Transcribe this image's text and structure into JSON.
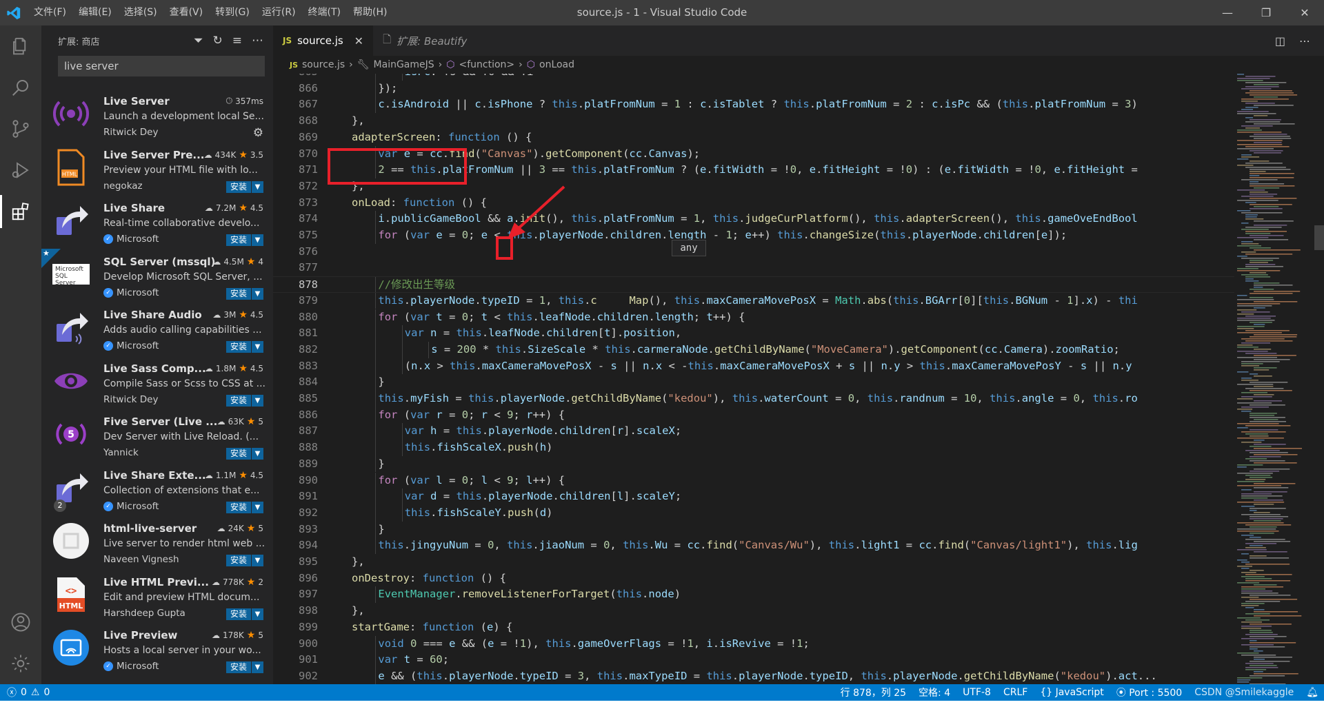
{
  "title_bar": {
    "menu": [
      "文件(F)",
      "编辑(E)",
      "选择(S)",
      "查看(V)",
      "转到(G)",
      "运行(R)",
      "终端(T)",
      "帮助(H)"
    ],
    "window_title": "source.js - 1 - Visual Studio Code",
    "controls": [
      "—",
      "❐",
      "✕"
    ]
  },
  "sidebar": {
    "header": "扩展: 商店",
    "search_value": "live server",
    "extensions": [
      {
        "name": "Live Server",
        "stats": "357ms",
        "stats_icon": "clock",
        "desc": "Launch a development local Se...",
        "publisher": "Ritwick Dey",
        "verified": false,
        "installed": true,
        "icon": "live-server"
      },
      {
        "name": "Live Server Pre...",
        "stats": "434K",
        "rating": "3.5",
        "desc": "Preview your HTML file with lo...",
        "publisher": "negokaz",
        "verified": false,
        "action": "安装",
        "icon": "html-file"
      },
      {
        "name": "Live Share",
        "stats": "7.2M",
        "rating": "4.5",
        "desc": "Real-time collaborative develo...",
        "publisher": "Microsoft",
        "verified": true,
        "action": "安装",
        "icon": "share-arrow"
      },
      {
        "name": "SQL Server (mssql)",
        "stats": "4.5M",
        "rating": "4",
        "desc": "Develop Microsoft SQL Server, ...",
        "publisher": "Microsoft",
        "verified": true,
        "action": "安装",
        "icon": "sql-server",
        "icon_text": "Microsoft SQL Server",
        "featured": true
      },
      {
        "name": "Live Share Audio",
        "stats": "3M",
        "rating": "4.5",
        "desc": "Adds audio calling capabilities ...",
        "publisher": "Microsoft",
        "verified": true,
        "action": "安装",
        "icon": "share-audio"
      },
      {
        "name": "Live Sass Comp...",
        "stats": "1.8M",
        "rating": "4.5",
        "desc": "Compile Sass or Scss to CSS at ...",
        "publisher": "Ritwick Dey",
        "verified": false,
        "action": "安装",
        "icon": "eye"
      },
      {
        "name": "Five Server (Live ...",
        "stats": "63K",
        "rating": "5",
        "desc": "Dev Server with Live Reload. (...",
        "publisher": "Yannick",
        "verified": false,
        "action": "安装",
        "icon": "five-server"
      },
      {
        "name": "Live Share Exte...",
        "stats": "1.1M",
        "rating": "4.5",
        "desc": "Collection of extensions that e...",
        "publisher": "Microsoft",
        "verified": true,
        "action": "安装",
        "icon": "share-arrow",
        "badge": "2"
      },
      {
        "name": "html-live-server",
        "stats": "24K",
        "rating": "5",
        "desc": "Live server to render html web ...",
        "publisher": "Naveen Vignesh",
        "verified": false,
        "action": "安装",
        "icon": "html-live"
      },
      {
        "name": "Live HTML Previ...",
        "stats": "778K",
        "rating": "2",
        "desc": "Edit and preview HTML docum...",
        "publisher": "Harshdeep Gupta",
        "verified": false,
        "action": "安装",
        "icon": "html5"
      },
      {
        "name": "Live Preview",
        "stats": "178K",
        "rating": "5",
        "desc": "Hosts a local server in your wo...",
        "publisher": "Microsoft",
        "verified": true,
        "action": "安装",
        "icon": "live-preview"
      }
    ]
  },
  "tabs": [
    {
      "label": "source.js",
      "prefix": "JS",
      "active": true
    },
    {
      "label": "扩展: Beautify",
      "active": false
    }
  ],
  "breadcrumb": {
    "file": "source.js",
    "file_prefix": "JS",
    "items": [
      "MainGameJS",
      "<function>",
      "onLoad"
    ]
  },
  "hover_tooltip": "any",
  "status_bar": {
    "errors": "0",
    "warnings": "0",
    "position": "行 878，列 25",
    "indent": "空格: 4",
    "encoding": "UTF-8",
    "eol": "CRLF",
    "language": "{} JavaScript",
    "port": "Port : 5500",
    "watermark": "CSDN @Smilekaggle"
  },
  "colors": {
    "accent": "#007acc",
    "annotation": "#e8202a"
  }
}
